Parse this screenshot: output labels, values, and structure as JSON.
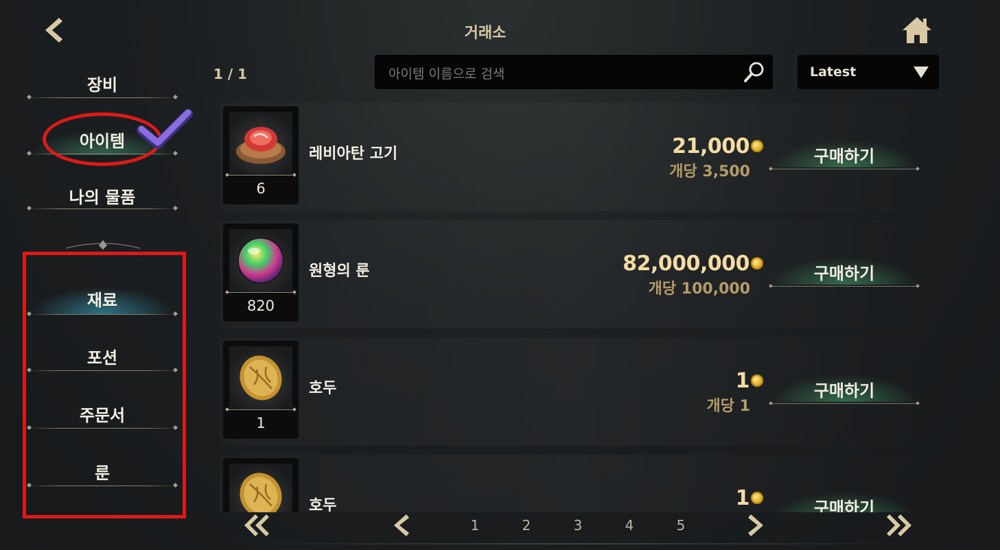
{
  "header": {
    "title": "거래소"
  },
  "sidebar": {
    "main": [
      {
        "label": "장비"
      },
      {
        "label": "아이템"
      },
      {
        "label": "나의 물품"
      }
    ],
    "sub": [
      {
        "label": "재료"
      },
      {
        "label": "포션"
      },
      {
        "label": "주문서"
      },
      {
        "label": "룬"
      }
    ]
  },
  "toolbar": {
    "page_count": "1 / 1",
    "search_placeholder": "아이템 이름으로 검색",
    "sort_label": "Latest"
  },
  "items": [
    {
      "name": "레비아탄 고기",
      "qty": "6",
      "price": "21,000",
      "unit_price": "개당 3,500",
      "buy_label": "구매하기",
      "icon": "meat-icon"
    },
    {
      "name": "원형의 룬",
      "qty": "820",
      "price": "82,000,000",
      "unit_price": "개당 100,000",
      "buy_label": "구매하기",
      "icon": "rune-orb-icon"
    },
    {
      "name": "호두",
      "qty": "1",
      "price": "1",
      "unit_price": "개당 1",
      "buy_label": "구매하기",
      "icon": "walnut-icon"
    },
    {
      "name": "호두",
      "qty": "",
      "price": "1",
      "unit_price": "",
      "buy_label": "구매하기",
      "icon": "walnut-icon"
    }
  ],
  "pagination": {
    "pages": [
      "1",
      "2",
      "3",
      "4",
      "5"
    ]
  },
  "colors": {
    "gold": "#f6dba2",
    "annotation_red": "#e11818",
    "checkmark_purple": "#7a5cd6"
  }
}
